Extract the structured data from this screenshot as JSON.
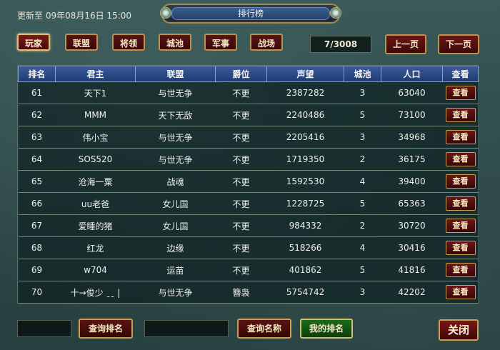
{
  "update_text": "更新至 09年08月16日 15:00",
  "title": "排行榜",
  "tabs": [
    {
      "label": "玩家",
      "active": true
    },
    {
      "label": "联盟",
      "active": false
    },
    {
      "label": "将领",
      "active": false
    },
    {
      "label": "城池",
      "active": false
    },
    {
      "label": "军事",
      "active": false
    },
    {
      "label": "战场",
      "active": false
    }
  ],
  "pagination": {
    "indicator": "7/3008",
    "prev_label": "上一页",
    "next_label": "下一页"
  },
  "columns": [
    "排名",
    "君主",
    "联盟",
    "爵位",
    "声望",
    "城池",
    "人口",
    "查看"
  ],
  "rows": [
    {
      "rank": "61",
      "lord": "天下1",
      "alliance": "与世无争",
      "title": "不更",
      "prestige": "2387282",
      "cities": "3",
      "population": "63040",
      "view": "查看"
    },
    {
      "rank": "62",
      "lord": "MMM",
      "alliance": "天下无敌",
      "title": "不更",
      "prestige": "2240486",
      "cities": "5",
      "population": "73100",
      "view": "查看"
    },
    {
      "rank": "63",
      "lord": "伟小宝",
      "alliance": "与世无争",
      "title": "不更",
      "prestige": "2205416",
      "cities": "3",
      "population": "34968",
      "view": "查看"
    },
    {
      "rank": "64",
      "lord": "SOS520",
      "alliance": "与世无争",
      "title": "不更",
      "prestige": "1719350",
      "cities": "2",
      "population": "36175",
      "view": "查看"
    },
    {
      "rank": "65",
      "lord": "沧海一粟",
      "alliance": "战魂",
      "title": "不更",
      "prestige": "1592530",
      "cities": "4",
      "population": "39400",
      "view": "查看"
    },
    {
      "rank": "66",
      "lord": "uu老爸",
      "alliance": "女儿国",
      "title": "不更",
      "prestige": "1228725",
      "cities": "5",
      "population": "65363",
      "view": "查看"
    },
    {
      "rank": "67",
      "lord": "爱睡的猪",
      "alliance": "女儿国",
      "title": "不更",
      "prestige": "984332",
      "cities": "2",
      "population": "30720",
      "view": "查看"
    },
    {
      "rank": "68",
      "lord": "红龙",
      "alliance": "边缘",
      "title": "不更",
      "prestige": "518266",
      "cities": "4",
      "population": "30416",
      "view": "查看"
    },
    {
      "rank": "69",
      "lord": "w704",
      "alliance": "运苗",
      "title": "不更",
      "prestige": "401862",
      "cities": "5",
      "population": "41816",
      "view": "查看"
    },
    {
      "rank": "70",
      "lord": "十→俊少 ˍˍ |",
      "alliance": "与世无争",
      "title": "簪袅",
      "prestige": "5754742",
      "cities": "3",
      "population": "42202",
      "view": "查看"
    }
  ],
  "bottom": {
    "search_rank_label": "查询排名",
    "search_name_label": "查询名称",
    "my_rank_label": "我的排名",
    "close_label": "关闭"
  }
}
